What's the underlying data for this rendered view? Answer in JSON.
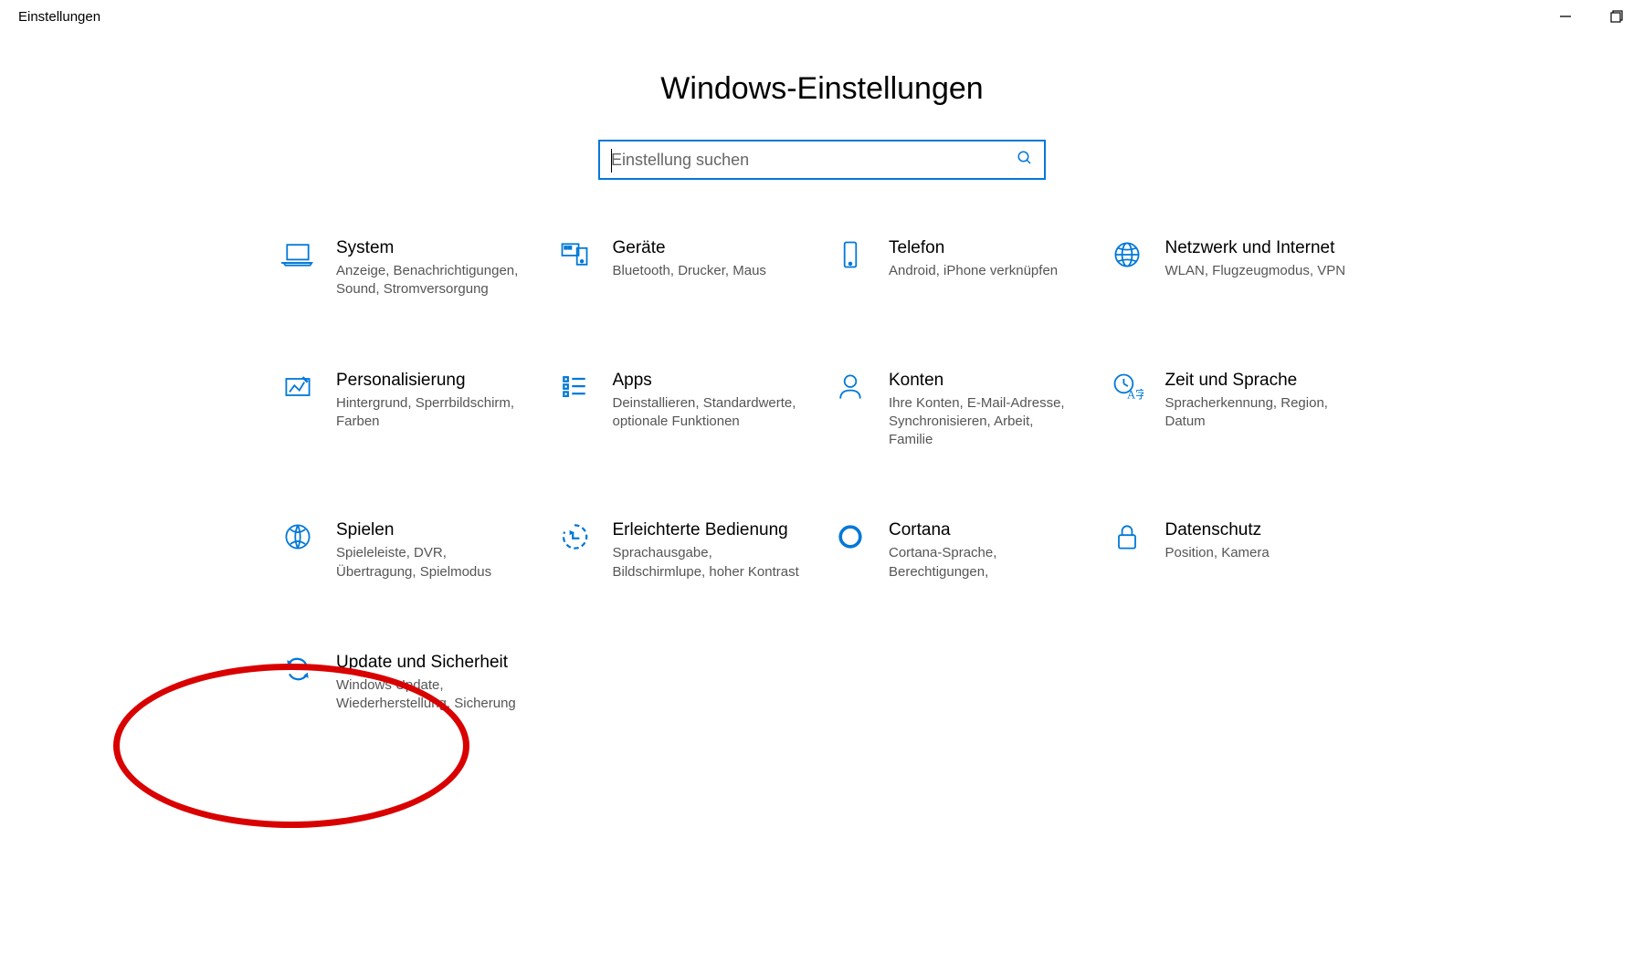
{
  "window": {
    "title": "Einstellungen"
  },
  "page": {
    "heading": "Windows-Einstellungen"
  },
  "search": {
    "placeholder": "Einstellung suchen"
  },
  "tiles": [
    {
      "id": "system",
      "title": "System",
      "desc": "Anzeige, Benachrichtigungen, Sound, Stromversorgung"
    },
    {
      "id": "devices",
      "title": "Geräte",
      "desc": "Bluetooth, Drucker, Maus"
    },
    {
      "id": "phone",
      "title": "Telefon",
      "desc": "Android, iPhone verknüpfen"
    },
    {
      "id": "network",
      "title": "Netzwerk und Internet",
      "desc": "WLAN, Flugzeugmodus, VPN"
    },
    {
      "id": "personalization",
      "title": "Personalisierung",
      "desc": "Hintergrund, Sperrbildschirm, Farben"
    },
    {
      "id": "apps",
      "title": "Apps",
      "desc": "Deinstallieren, Standardwerte, optionale Funktionen"
    },
    {
      "id": "accounts",
      "title": "Konten",
      "desc": "Ihre Konten, E-Mail-Adresse, Synchronisieren, Arbeit, Familie"
    },
    {
      "id": "time",
      "title": "Zeit und Sprache",
      "desc": "Spracherkennung, Region, Datum"
    },
    {
      "id": "gaming",
      "title": "Spielen",
      "desc": "Spieleleiste, DVR, Übertragung, Spielmodus"
    },
    {
      "id": "ease",
      "title": "Erleichterte Bedienung",
      "desc": "Sprachausgabe, Bildschirmlupe, hoher Kontrast"
    },
    {
      "id": "cortana",
      "title": "Cortana",
      "desc": "Cortana-Sprache, Berechtigungen,"
    },
    {
      "id": "privacy",
      "title": "Datenschutz",
      "desc": "Position, Kamera"
    },
    {
      "id": "update",
      "title": "Update und Sicherheit",
      "desc": "Windows Update, Wiederherstellung, Sicherung"
    }
  ],
  "colors": {
    "accent": "#0078D7",
    "annotation": "#d90000"
  }
}
